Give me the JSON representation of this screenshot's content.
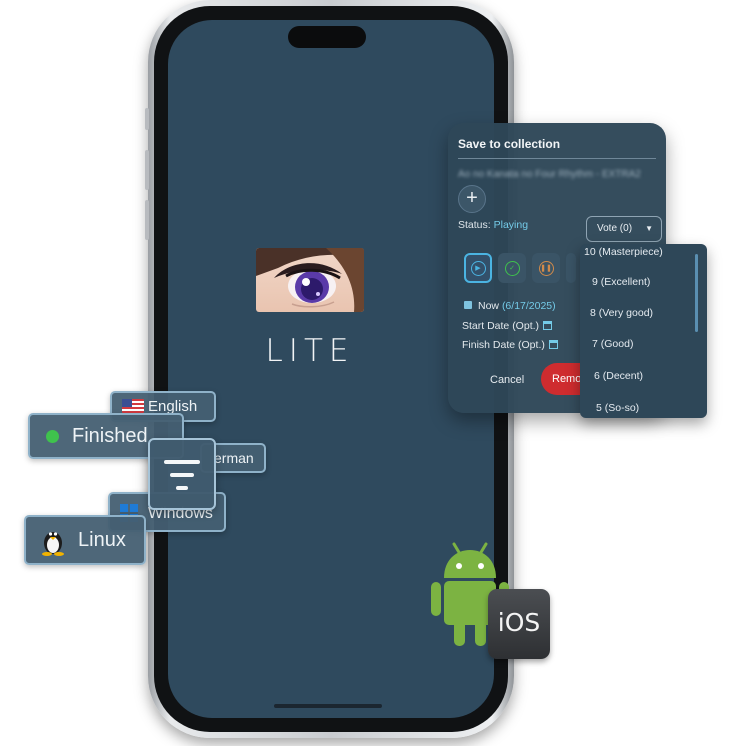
{
  "app": {
    "logo_text": "LITE"
  },
  "dialog": {
    "title": "Save to collection",
    "subtitle": "Ao no Kanata no Four Rhythm - EXTRA2",
    "add_label": "+",
    "status_label": "Status:",
    "status_value": "Playing",
    "vote_label": "Vote (0)",
    "now_label": "Now",
    "now_date": "(6/17/2025)",
    "start_date_label": "Start Date (Opt.)",
    "finish_date_label": "Finish Date (Opt.)",
    "cancel_label": "Cancel",
    "remove_label": "Remove"
  },
  "vote_options": [
    "10 (Masterpiece)",
    "9 (Excellent)",
    "8 (Very good)",
    "7 (Good)",
    "6 (Decent)",
    "5 (So-so)"
  ],
  "chips": {
    "english": "English",
    "german": "erman",
    "finished": "Finished",
    "windows": "Windows",
    "linux": "Linux"
  },
  "platforms": {
    "ios": "iOS"
  },
  "colors": {
    "screen_bg": "#2f4a5e",
    "accent": "#74cbe8",
    "remove_red": "#cf2c2f",
    "android_green": "#7cb342",
    "finished_green": "#3fc24d"
  }
}
